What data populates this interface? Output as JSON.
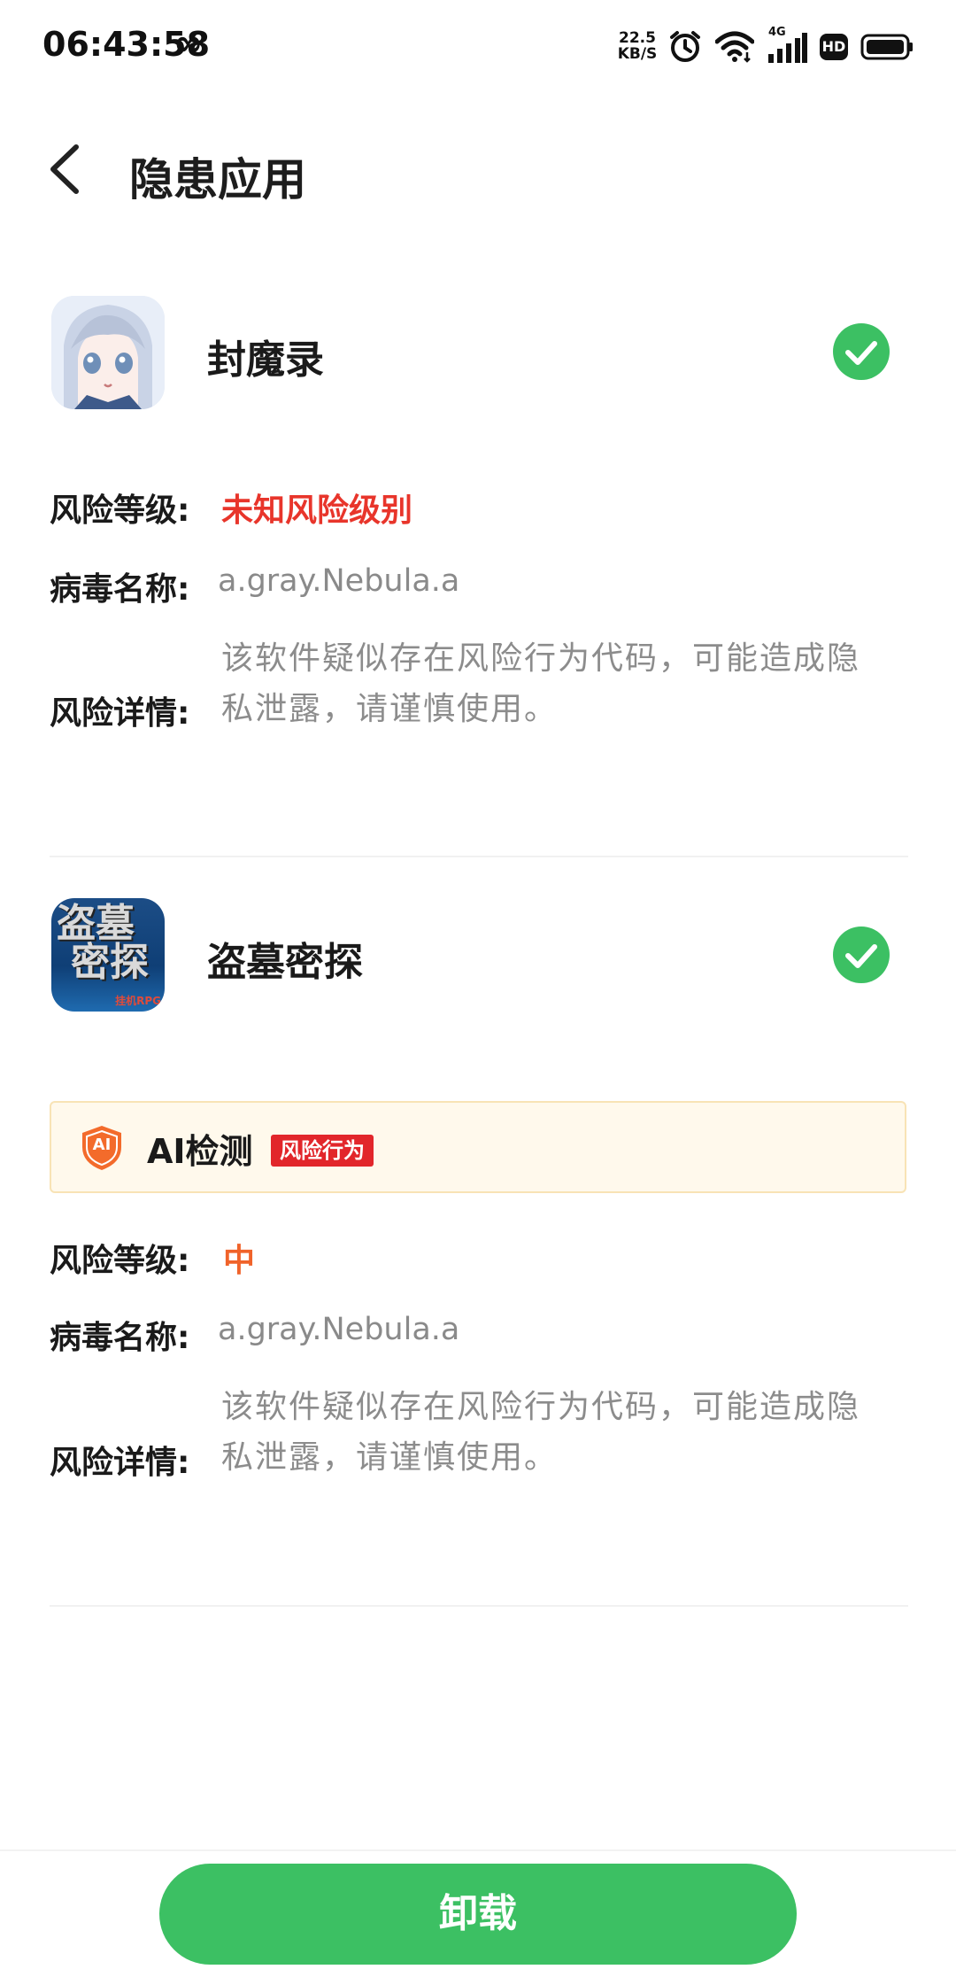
{
  "status_bar": {
    "time": "06:43:58",
    "infinity_symbol": "∞",
    "net_speed_value": "22.5",
    "net_speed_unit": "KB/S",
    "signal_label": "4G",
    "hd_label": "HD",
    "icons": [
      "alarm-icon",
      "wifi-icon",
      "signal-icon",
      "hd-icon",
      "battery-icon"
    ]
  },
  "header": {
    "title": "隐患应用"
  },
  "apps": [
    {
      "name": "封魔录",
      "risk_label": "风险等级:",
      "risk_value": "未知风险级别",
      "virus_label": "病毒名称:",
      "virus_value": "a.gray.Nebula.a",
      "detail_label": "风险详情:",
      "detail_value": "该软件疑似存在风险行为代码，可能造成隐私泄露，请谨慎使用。"
    },
    {
      "name": "盗墓密探",
      "icon_text_line1": "盗墓",
      "icon_text_line2": "密探",
      "icon_badge": "挂机RPG",
      "ai": {
        "title": "AI检测",
        "shield_text": "AI",
        "badge": "风险行为"
      },
      "risk_label": "风险等级:",
      "risk_value": "中",
      "virus_label": "病毒名称:",
      "virus_value": "a.gray.Nebula.a",
      "detail_label": "风险详情:",
      "detail_value": "该软件疑似存在风险行为代码，可能造成隐私泄露，请谨慎使用。"
    }
  ],
  "footer": {
    "uninstall_label": "卸载"
  },
  "colors": {
    "accent_green": "#3cc063",
    "risk_red": "#e8352b",
    "risk_orange": "#f0632a",
    "ai_badge_red": "#e2262b"
  }
}
